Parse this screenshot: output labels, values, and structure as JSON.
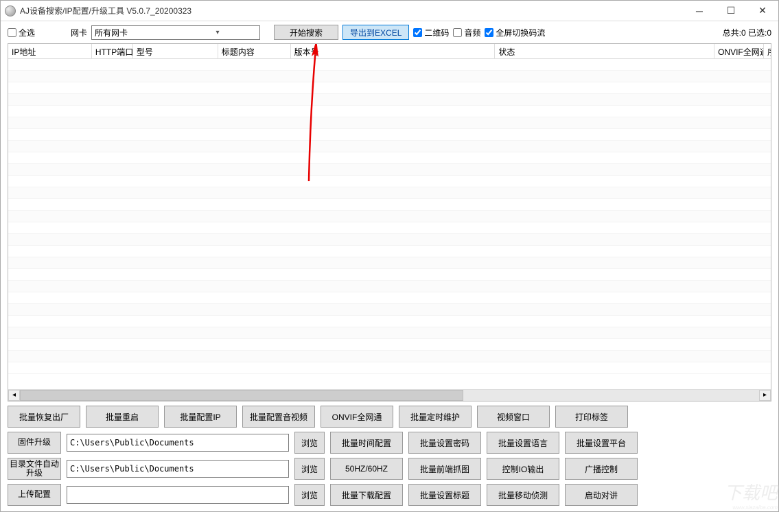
{
  "title": "AJ设备搜索/IP配置/升级工具 V5.0.7_20200323",
  "toolbar": {
    "select_all": "全选",
    "nic_label": "网卡",
    "nic_value": "所有网卡",
    "start_search": "开始搜索",
    "export_excel": "导出到EXCEL",
    "qrcode": "二维码",
    "audio": "音频",
    "fullscreen_stream": "全屏切换码流",
    "total_label": "总共:0 已选:0"
  },
  "columns": {
    "ip": "IP地址",
    "http_port": "HTTP端口",
    "model": "型号",
    "title_content": "标题内容",
    "version": "版本号",
    "status": "状态",
    "onvif": "ONVIF全网通",
    "serial": "序列号"
  },
  "row1": {
    "factory_reset": "批量恢复出厂",
    "reboot": "批量重启",
    "config_ip": "批量配置IP",
    "config_av": "批量配置音视频",
    "onvif": "ONVIF全网通",
    "timed_maint": "批量定时维护",
    "video_window": "视频窗口",
    "print_label": "打印标签"
  },
  "row2": {
    "firmware": "固件升级",
    "path": "C:\\Users\\Public\\Documents",
    "browse": "浏览",
    "time_config": "批量时间配置",
    "set_password": "批量设置密码",
    "set_language": "批量设置语言",
    "set_platform": "批量设置平台"
  },
  "row3": {
    "dir_auto": "目录文件自动升级",
    "path": "C:\\Users\\Public\\Documents",
    "browse": "浏览",
    "hz": "50HZ/60HZ",
    "front_snap": "批量前端抓图",
    "io_output": "控制IO输出",
    "broadcast": "广播控制"
  },
  "row4": {
    "upload": "上传配置",
    "path": "",
    "browse": "浏览",
    "download": "批量下载配置",
    "set_title": "批量设置标题",
    "mobile_detect": "批量移动侦测",
    "intercom": "启动对讲"
  }
}
